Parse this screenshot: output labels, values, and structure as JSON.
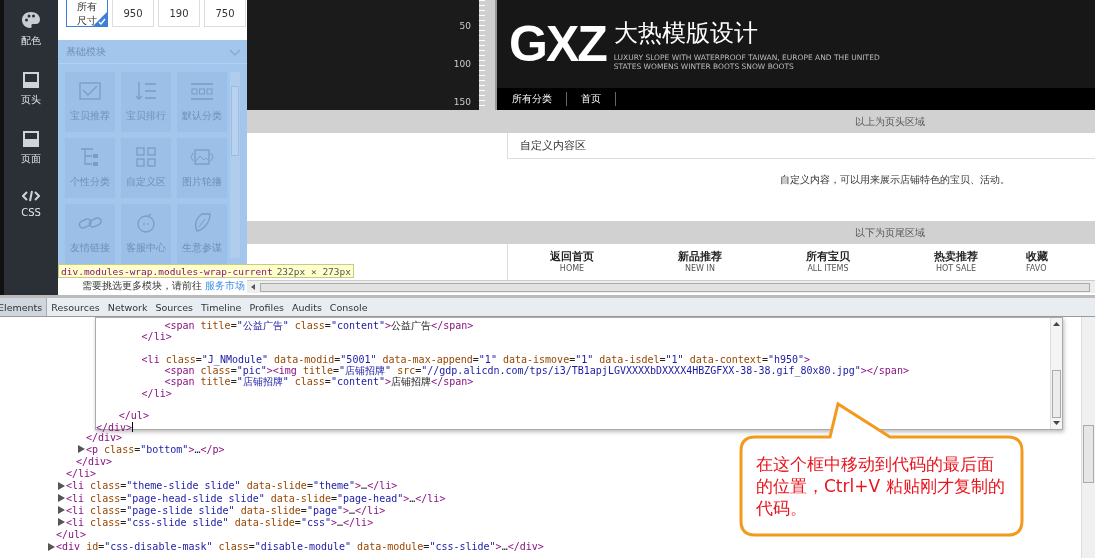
{
  "sidebar": {
    "items": [
      {
        "label": "配色",
        "selected": false
      },
      {
        "label": "页头",
        "selected": false
      },
      {
        "label": "页面",
        "selected": false
      },
      {
        "label": "CSS",
        "selected": false
      }
    ]
  },
  "size_options": [
    {
      "label": "所有尺寸",
      "selected": true
    },
    {
      "label": "950",
      "selected": false
    },
    {
      "label": "190",
      "selected": false
    },
    {
      "label": "750",
      "selected": false
    }
  ],
  "module_panel": {
    "title": "基础模块",
    "modules": [
      "宝贝推荐",
      "宝贝排行",
      "默认分类",
      "个性分类",
      "自定义区",
      "图片轮播",
      "友情链接",
      "客服中心",
      "生意参谋"
    ]
  },
  "element_tooltip": {
    "selector": "div.modules-wrap.modules-wrap-current",
    "size": "232px × 273px"
  },
  "more_modules": {
    "text": "需要挑选更多模块，请前往",
    "link": "服务市场"
  },
  "ruler": {
    "marks": [
      "50",
      "100",
      "150"
    ]
  },
  "shop_header": {
    "logo": "GXZ",
    "title": "大热模版设计",
    "tagline": [
      "LUXURY SLOPE WITH WATERPROOF TAIWAN, EUROPE AND THE UNITED",
      "STATES WOMENS WINTER BOOTS SNOW BOOTS"
    ],
    "nav": [
      "所有分类",
      "首页"
    ]
  },
  "header_divider": "以上为页头区域",
  "custom_area": {
    "title": "自定义内容区",
    "text": "自定义内容，可以用来展示店铺特色的宝贝、活动。"
  },
  "footer_divider": "以下为页尾区域",
  "footer_links": [
    {
      "title": "返回首页",
      "subtitle": "HOME"
    },
    {
      "title": "新品推荐",
      "subtitle": "NEW IN"
    },
    {
      "title": "所有宝贝",
      "subtitle": "ALL ITEMS"
    },
    {
      "title": "热卖推荐",
      "subtitle": "HOT SALE"
    },
    {
      "title": "收藏",
      "subtitle": "FAVO"
    }
  ],
  "devtools": {
    "tabs": [
      {
        "label": "Elements",
        "selected": true
      },
      {
        "label": "Resources",
        "selected": false
      },
      {
        "label": "Network",
        "selected": false
      },
      {
        "label": "Sources",
        "selected": false
      },
      {
        "label": "Timeline",
        "selected": false
      },
      {
        "label": "Profiles",
        "selected": false
      },
      {
        "label": "Audits",
        "selected": false
      },
      {
        "label": "Console",
        "selected": false
      }
    ],
    "editor": [
      {
        "children": [
          {
            "children": [
              {
                "children": [
                  {
                    "text": "<span title=\"公益广告\" class=\"content\">公益广告</span>"
                  }
                ]
              },
              {
                "text": "</li>"
              },
              {
                "text": "<li class=\"J_NModule\" data-modid=\"5001\" data-max-append=\"1\" data-ismove=\"1\" data-isdel=\"1\" data-context=\"h950\">",
                "blank_before": true
              },
              {
                "children": [
                  {
                    "text": "<span class=\"pic\"><img title=\"店铺招牌\" src=\"//gdp.alicdn.com/tps/i3/TB1apjLGVXXXXbDXXXX4HBZGFXX-38-38.gif_80x80.jpg\"></span>"
                  },
                  {
                    "text": "<span title=\"店铺招牌\" class=\"content\">店铺招牌</span>"
                  }
                ]
              },
              {
                "text": "</li>"
              }
            ]
          },
          {
            "text": "</ul>",
            "blank_before": true
          }
        ]
      },
      {
        "text": "</div>",
        "caret": true
      }
    ],
    "tree": [
      {
        "children": [
          {
            "children": [
              {
                "children": [
                  {
                    "text": "</div>"
                  },
                  {
                    "text": "<p class=\"bottom\">…</p>",
                    "expanded": false
                  }
                ]
              },
              {
                "text": "</div>"
              }
            ]
          },
          {
            "text": "</li>"
          },
          {
            "text": "<li class=\"theme-slide slide\" data-slide=\"theme\">…</li>",
            "expanded": false
          },
          {
            "text": "<li class=\"page-head-slide slide\" data-slide=\"page-head\">…</li>",
            "expanded": false
          },
          {
            "text": "<li class=\"page-slide slide\" data-slide=\"page\">…</li>",
            "expanded": false
          },
          {
            "text": "<li class=\"css-slide slide\" data-slide=\"css\">…</li>",
            "expanded": false
          }
        ]
      },
      {
        "text": "</ul>"
      },
      {
        "text": "<div id=\"css-disable-mask\" class=\"disable-module\" data-module=\"css-slide\">…</div>",
        "expanded": false
      }
    ]
  },
  "callout": {
    "text": "在这个框中移动到代码的最后面的位置，Ctrl+V 粘贴刚才复制的代码。"
  }
}
